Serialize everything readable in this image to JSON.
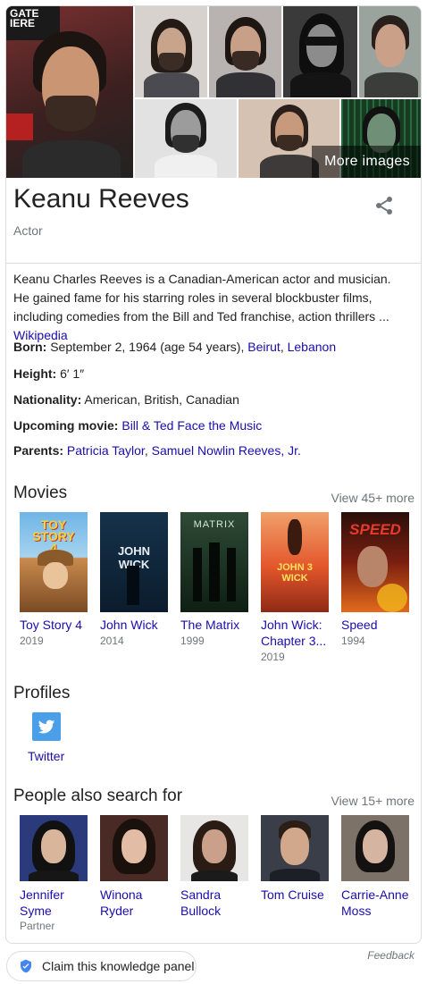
{
  "photos": {
    "more_images_label": "More images",
    "first_photo_text": "GATE\nIERE"
  },
  "header": {
    "title": "Keanu Reeves",
    "subtitle": "Actor"
  },
  "description": {
    "text": "Keanu Charles Reeves is a Canadian-American actor and musician. He gained fame for his starring roles in several blockbuster films, including comedies from the Bill and Ted franchise, action thrillers ... ",
    "source_link": "Wikipedia"
  },
  "facts": {
    "born": {
      "label": "Born:",
      "value": "September 2, 1964 (age 54 years), ",
      "link1": "Beirut",
      "sep": ", ",
      "link2": "Lebanon"
    },
    "height": {
      "label": "Height:",
      "value": "6′ 1″"
    },
    "nationality": {
      "label": "Nationality:",
      "value": "American, British, Canadian"
    },
    "upcoming": {
      "label": "Upcoming movie:",
      "link": "Bill & Ted Face the Music"
    },
    "parents": {
      "label": "Parents:",
      "link1": "Patricia Taylor",
      "sep": ", ",
      "link2": "Samuel Nowlin Reeves, Jr."
    }
  },
  "movies": {
    "title": "Movies",
    "view_more": "View 45+ more",
    "items": [
      {
        "name": "Toy Story 4",
        "year": "2019",
        "poster_text": "TOY STORY 4"
      },
      {
        "name": "John Wick",
        "year": "2014",
        "poster_text": "JOHN WICK"
      },
      {
        "name": "The Matrix",
        "year": "1999",
        "poster_text": "MATRIX"
      },
      {
        "name": "John Wick: Chapter 3...",
        "year": "2019",
        "poster_text": "JOHN 3 WICK"
      },
      {
        "name": "Speed",
        "year": "1994",
        "poster_text": "SPEED"
      }
    ]
  },
  "profiles": {
    "title": "Profiles",
    "twitter_label": "Twitter"
  },
  "people": {
    "title": "People also search for",
    "view_more": "View 15+ more",
    "items": [
      {
        "name": "Jennifer Syme",
        "sub": "Partner"
      },
      {
        "name": "Winona Ryder",
        "sub": ""
      },
      {
        "name": "Sandra Bullock",
        "sub": ""
      },
      {
        "name": "Tom Cruise",
        "sub": ""
      },
      {
        "name": "Carrie-Anne Moss",
        "sub": ""
      }
    ]
  },
  "footer": {
    "feedback": "Feedback",
    "claim_label": "Claim this knowledge panel"
  },
  "colors": {
    "link": "#1a0dab",
    "muted": "#70757a",
    "border": "#dadce0",
    "twitter": "#4b9ee8",
    "claim_shield": "#4285f4"
  }
}
